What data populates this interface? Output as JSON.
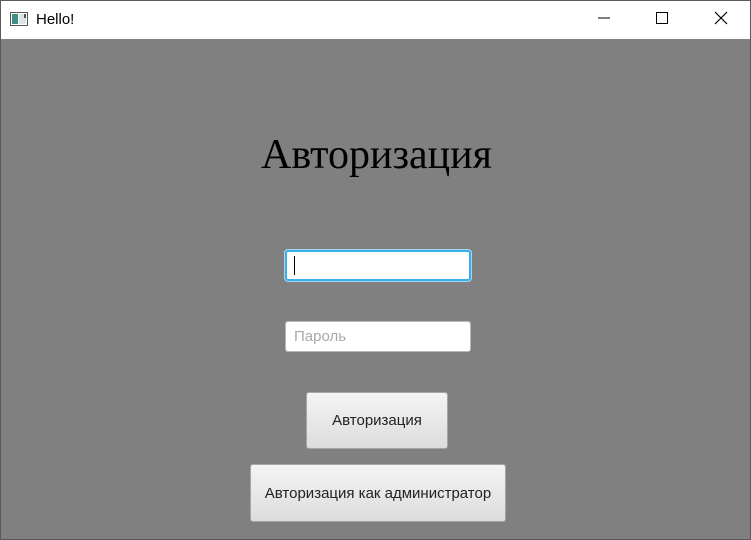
{
  "window": {
    "title": "Hello!",
    "controls": {
      "minimize": "minimize-icon",
      "maximize": "maximize-icon",
      "close": "close-icon"
    }
  },
  "form": {
    "heading": "Авторизация",
    "login": {
      "value": "",
      "placeholder": ""
    },
    "password": {
      "value": "",
      "placeholder": "Пароль"
    },
    "auth_button": "Авторизация",
    "admin_button": "Авторизация как администратор"
  },
  "colors": {
    "background": "#808080",
    "focus_accent": "#3daee9"
  }
}
